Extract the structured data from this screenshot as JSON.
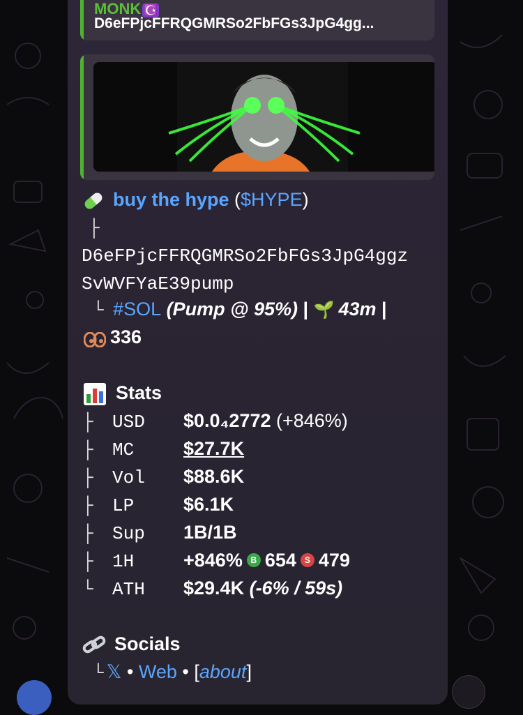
{
  "reply": {
    "name": "MONK",
    "emoji": "☪️",
    "address_preview": "D6eFPjcFFRQGMRSo2FbFGs3JpG4gg..."
  },
  "token": {
    "icon": "pill-icon",
    "name": "buy the hype",
    "ticker_open": " (",
    "ticker": "$HYPE",
    "ticker_close": ")",
    "tree_top": "├",
    "address_line1": "D6eFPjcFFRQGMRSo2FbFGs3JpG4ggz",
    "address_line2": "SvWVFYaE39pump",
    "tree_bottom": "└",
    "chain": "#SOL",
    "pump_prefix": " (Pump @ ",
    "pump_pct": "95%",
    "pump_suffix": ")",
    "sep": " | ",
    "age": "43m",
    "sep2": " |",
    "holders_icon": "eyes-icon",
    "holders": "336"
  },
  "stats": {
    "icon": "bar-chart-icon",
    "heading": "Stats",
    "rows": [
      {
        "tree": "├",
        "label": "USD",
        "value": "$0.0₄2772",
        "extra": " (+846%)"
      },
      {
        "tree": "├",
        "label": "MC",
        "value": "$27.7K"
      },
      {
        "tree": "├",
        "label": "Vol",
        "value": "$88.6K"
      },
      {
        "tree": "├",
        "label": "LP",
        "value": "$6.1K"
      },
      {
        "tree": "├",
        "label": "Sup",
        "value": "1B/1B"
      },
      {
        "tree": "├",
        "label": "1H",
        "value": "+846%",
        "buy_badge": "B",
        "buys": "654",
        "sell_badge": "S",
        "sells": "479"
      },
      {
        "tree": "└",
        "label": "ATH",
        "value": "$29.4K",
        "extra": " (-6% / 59s)"
      }
    ]
  },
  "socials": {
    "icon": "link-icon",
    "heading": "Socials",
    "tree": "└",
    "x_label": "𝕏",
    "bullet": " • ",
    "web_label": "Web",
    "bullet2": " • ",
    "bracket_open": "[",
    "about_label": "about",
    "bracket_close": "]"
  },
  "colors": {
    "bubble": "#2a2433",
    "accent_green": "#4fb332",
    "link_blue": "#5aa6ff"
  }
}
